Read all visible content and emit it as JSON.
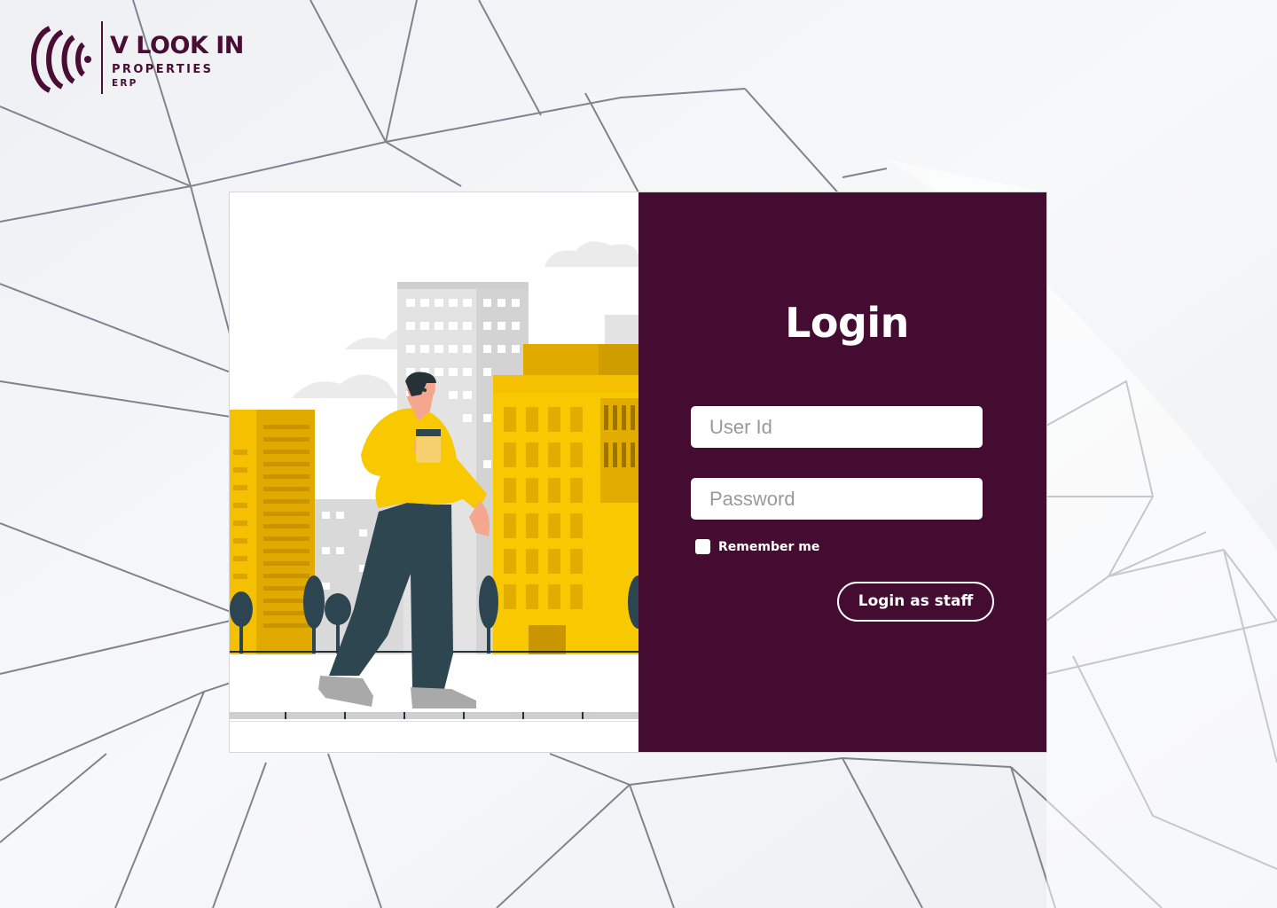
{
  "brand": {
    "name": "V LOOK IN",
    "line2": "PROPERTIES",
    "line3": "ERP"
  },
  "login": {
    "title": "Login",
    "user_placeholder": "User Id",
    "password_placeholder": "Password",
    "remember_label": "Remember me",
    "submit_label": "Login as staff"
  },
  "colors": {
    "primary": "#450c32",
    "accent_yellow": "#f6c500",
    "background": "#f4f5f7"
  },
  "icons": {
    "logo": "brand-mark-icon",
    "illustration": "man-walking-city-illustration"
  }
}
